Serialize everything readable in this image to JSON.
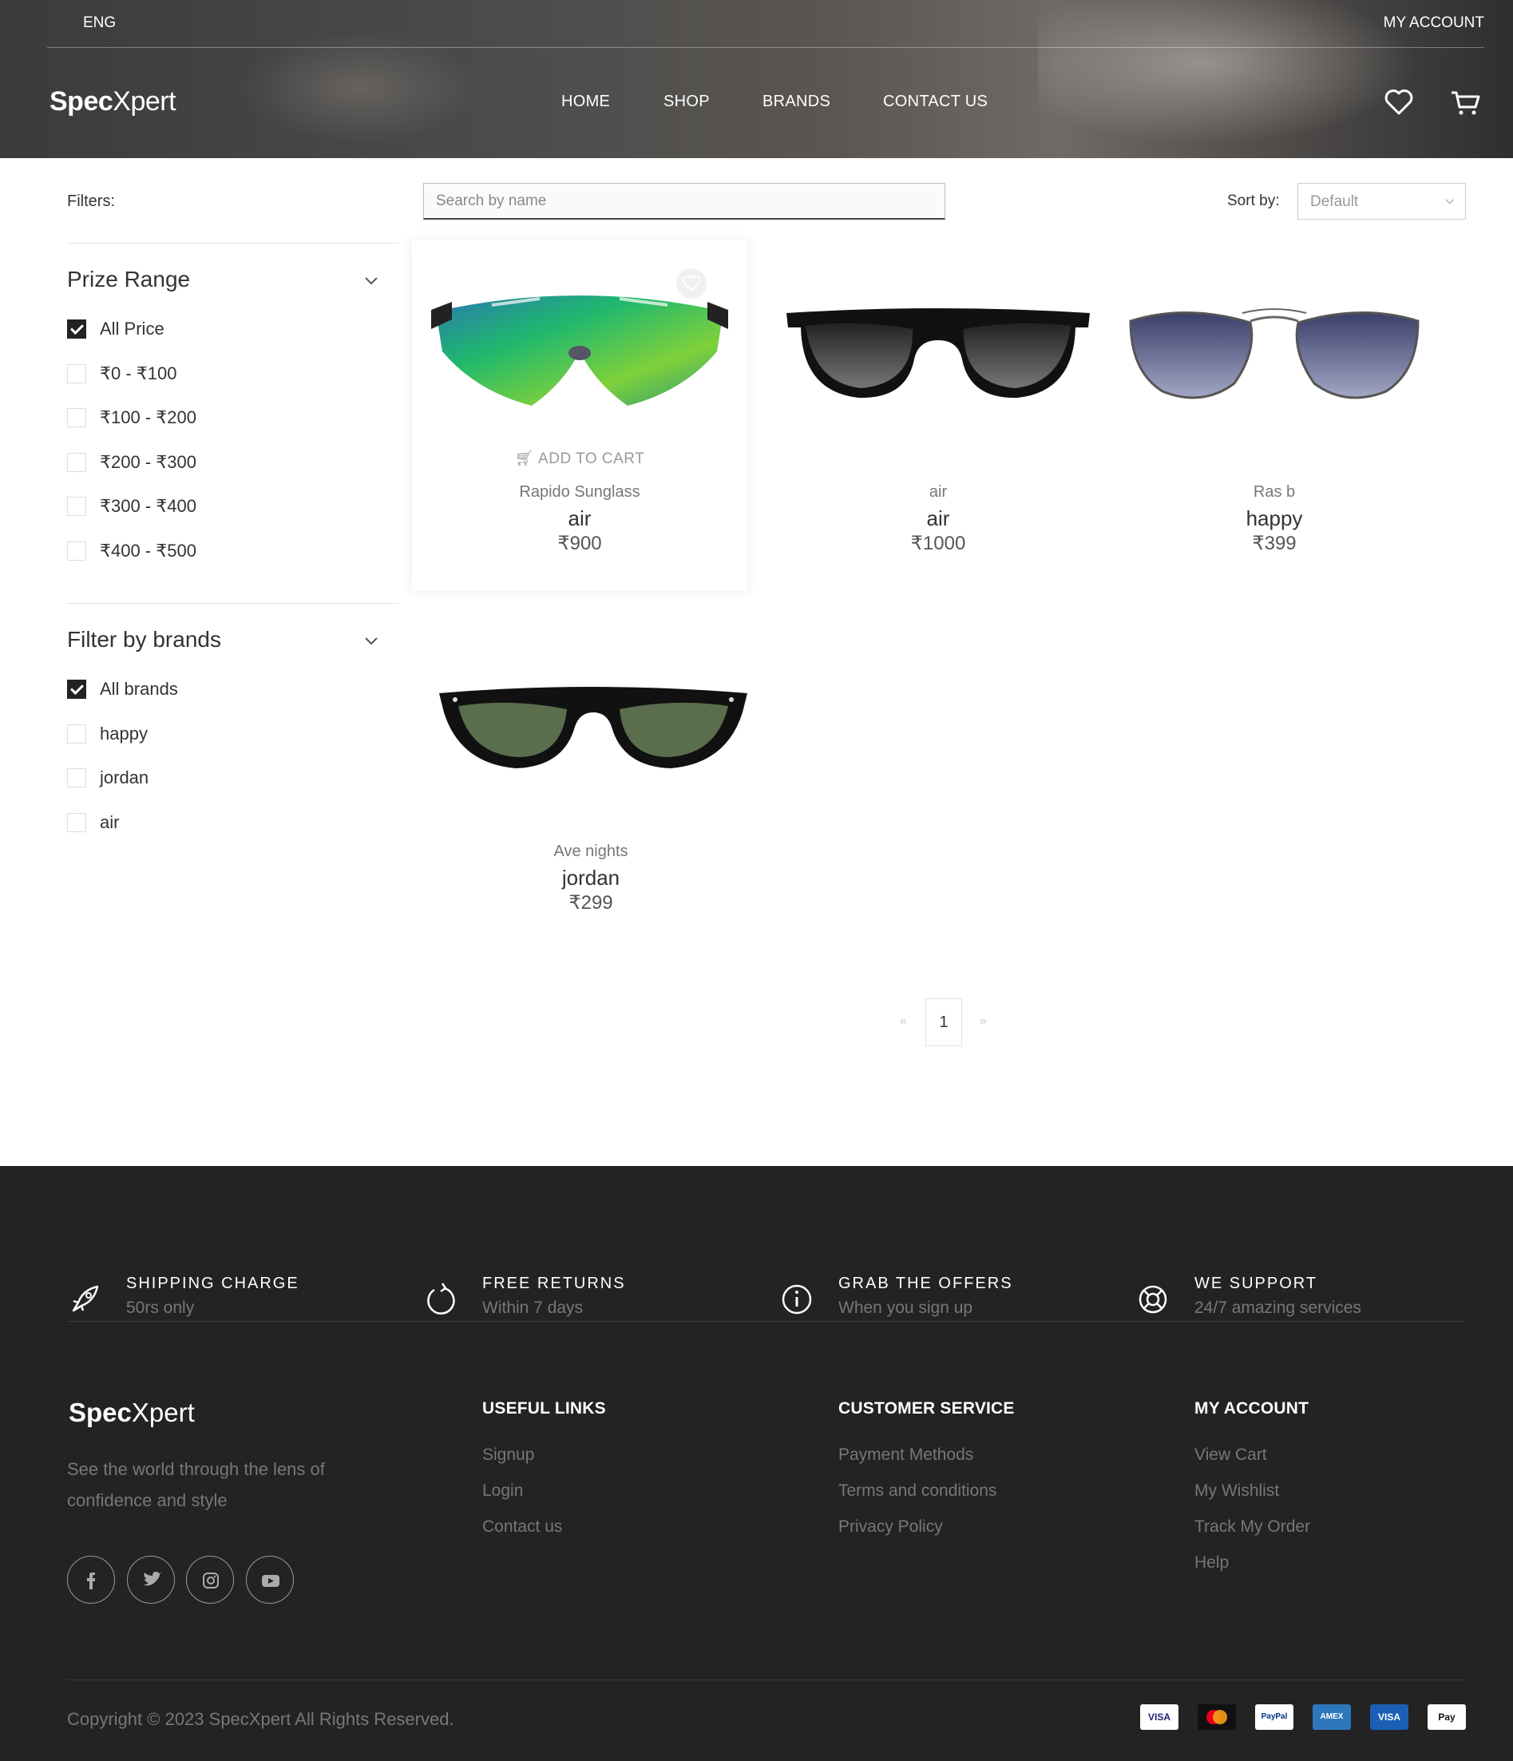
{
  "header": {
    "lang": "ENG",
    "my_account": "MY ACCOUNT",
    "logo_bold": "Spec",
    "logo_light": "Xpert",
    "nav": [
      "HOME",
      "SHOP",
      "BRANDS",
      "CONTACT US"
    ]
  },
  "toolbar": {
    "filters_label": "Filters:",
    "search_placeholder": "Search by name",
    "sort_label": "Sort by:",
    "sort_value": "Default"
  },
  "filters": {
    "price": {
      "title": "Prize Range",
      "options": [
        {
          "label": "All Price",
          "checked": true
        },
        {
          "label": "₹0 - ₹100",
          "checked": false
        },
        {
          "label": "₹100 - ₹200",
          "checked": false
        },
        {
          "label": "₹200 - ₹300",
          "checked": false
        },
        {
          "label": "₹300 - ₹400",
          "checked": false
        },
        {
          "label": "₹400 - ₹500",
          "checked": false
        }
      ]
    },
    "brands": {
      "title": "Filter by brands",
      "options": [
        {
          "label": "All brands",
          "checked": true
        },
        {
          "label": "happy",
          "checked": false
        },
        {
          "label": "jordan",
          "checked": false
        },
        {
          "label": "air",
          "checked": false
        }
      ]
    }
  },
  "products": [
    {
      "name": "Rapido Sunglass",
      "brand": "air",
      "price": "₹900",
      "add_to_cart": "ADD TO CART",
      "image": "sport-shield-green"
    },
    {
      "name": "air",
      "brand": "air",
      "price": "₹1000",
      "image": "square-black"
    },
    {
      "name": "Ras b",
      "brand": "happy",
      "price": "₹399",
      "image": "aviator-blue"
    },
    {
      "name": "Ave nights",
      "brand": "jordan",
      "price": "₹299",
      "image": "wayfarer-green"
    }
  ],
  "pagination": {
    "prev": "«",
    "current": "1",
    "next": "»"
  },
  "footer": {
    "features": [
      {
        "icon": "rocket-icon",
        "title": "SHIPPING CHARGE",
        "sub": "50rs only"
      },
      {
        "icon": "return-icon",
        "title": "FREE RETURNS",
        "sub": "Within 7 days"
      },
      {
        "icon": "info-icon",
        "title": "GRAB THE OFFERS",
        "sub": "When you sign up"
      },
      {
        "icon": "lifebuoy-icon",
        "title": "WE SUPPORT",
        "sub": "24/7 amazing services"
      }
    ],
    "logo_bold": "Spec",
    "logo_light": "Xpert",
    "tagline": "See the world through the lens of confidence and style",
    "social": [
      "facebook-icon",
      "twitter-icon",
      "instagram-icon",
      "youtube-icon"
    ],
    "columns": [
      {
        "title": "USEFUL LINKS",
        "links": [
          "Signup",
          "Login",
          "Contact us"
        ]
      },
      {
        "title": "CUSTOMER SERVICE",
        "links": [
          "Payment Methods",
          "Terms and conditions",
          "Privacy Policy"
        ]
      },
      {
        "title": "MY ACCOUNT",
        "links": [
          "View Cart",
          "My Wishlist",
          "Track My Order",
          "Help"
        ]
      }
    ],
    "copyright": "Copyright © 2023 SpecXpert All Rights Reserved.",
    "payments": [
      "VISA",
      "mastercard",
      "PayPal",
      "AMEX",
      "VISA",
      "Pay"
    ]
  }
}
